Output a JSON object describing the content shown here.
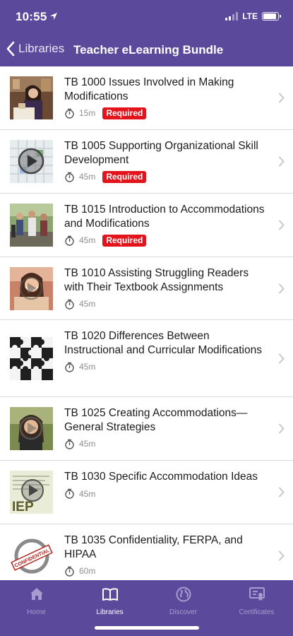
{
  "status_bar": {
    "time": "10:55",
    "network": "LTE",
    "location_icon": "location-arrow-icon",
    "signal_bars": 2
  },
  "nav": {
    "back_label": "Libraries",
    "title": "Teacher eLearning Bundle"
  },
  "courses": [
    {
      "title": "TB 1000 Issues Involved in Making Modifications",
      "duration": "15m",
      "badge": "Required"
    },
    {
      "title": "TB 1005 Supporting Organizational Skill Development",
      "duration": "45m",
      "badge": "Required"
    },
    {
      "title": "TB 1015 Introduction to Accommodations and Modifications",
      "duration": "45m",
      "badge": "Required"
    },
    {
      "title": "TB 1010 Assisting Struggling Readers with Their Textbook Assignments",
      "duration": "45m",
      "badge": ""
    },
    {
      "title": "TB 1020 Differences Between Instructional and Curricular Modifications",
      "duration": "45m",
      "badge": ""
    },
    {
      "title": "TB 1025 Creating Accommodations—General Strategies",
      "duration": "45m",
      "badge": ""
    },
    {
      "title": "TB 1030 Specific Accommodation Ideas",
      "duration": "45m",
      "badge": ""
    },
    {
      "title": "TB 1035 Confidentiality, FERPA, and HIPAA",
      "duration": "60m",
      "badge": ""
    }
  ],
  "thumb_text": {
    "iep": "IEP",
    "stamp": "CONFIDENTIAL"
  },
  "tabs": [
    {
      "label": "Home",
      "icon": "home-icon",
      "active": false
    },
    {
      "label": "Libraries",
      "icon": "book-icon",
      "active": true
    },
    {
      "label": "Discover",
      "icon": "globe-icon",
      "active": false
    },
    {
      "label": "Certificates",
      "icon": "certificate-icon",
      "active": false
    }
  ],
  "colors": {
    "brand": "#5b4a9c",
    "required_badge": "#e3141b",
    "tab_inactive": "#a79bd0"
  }
}
